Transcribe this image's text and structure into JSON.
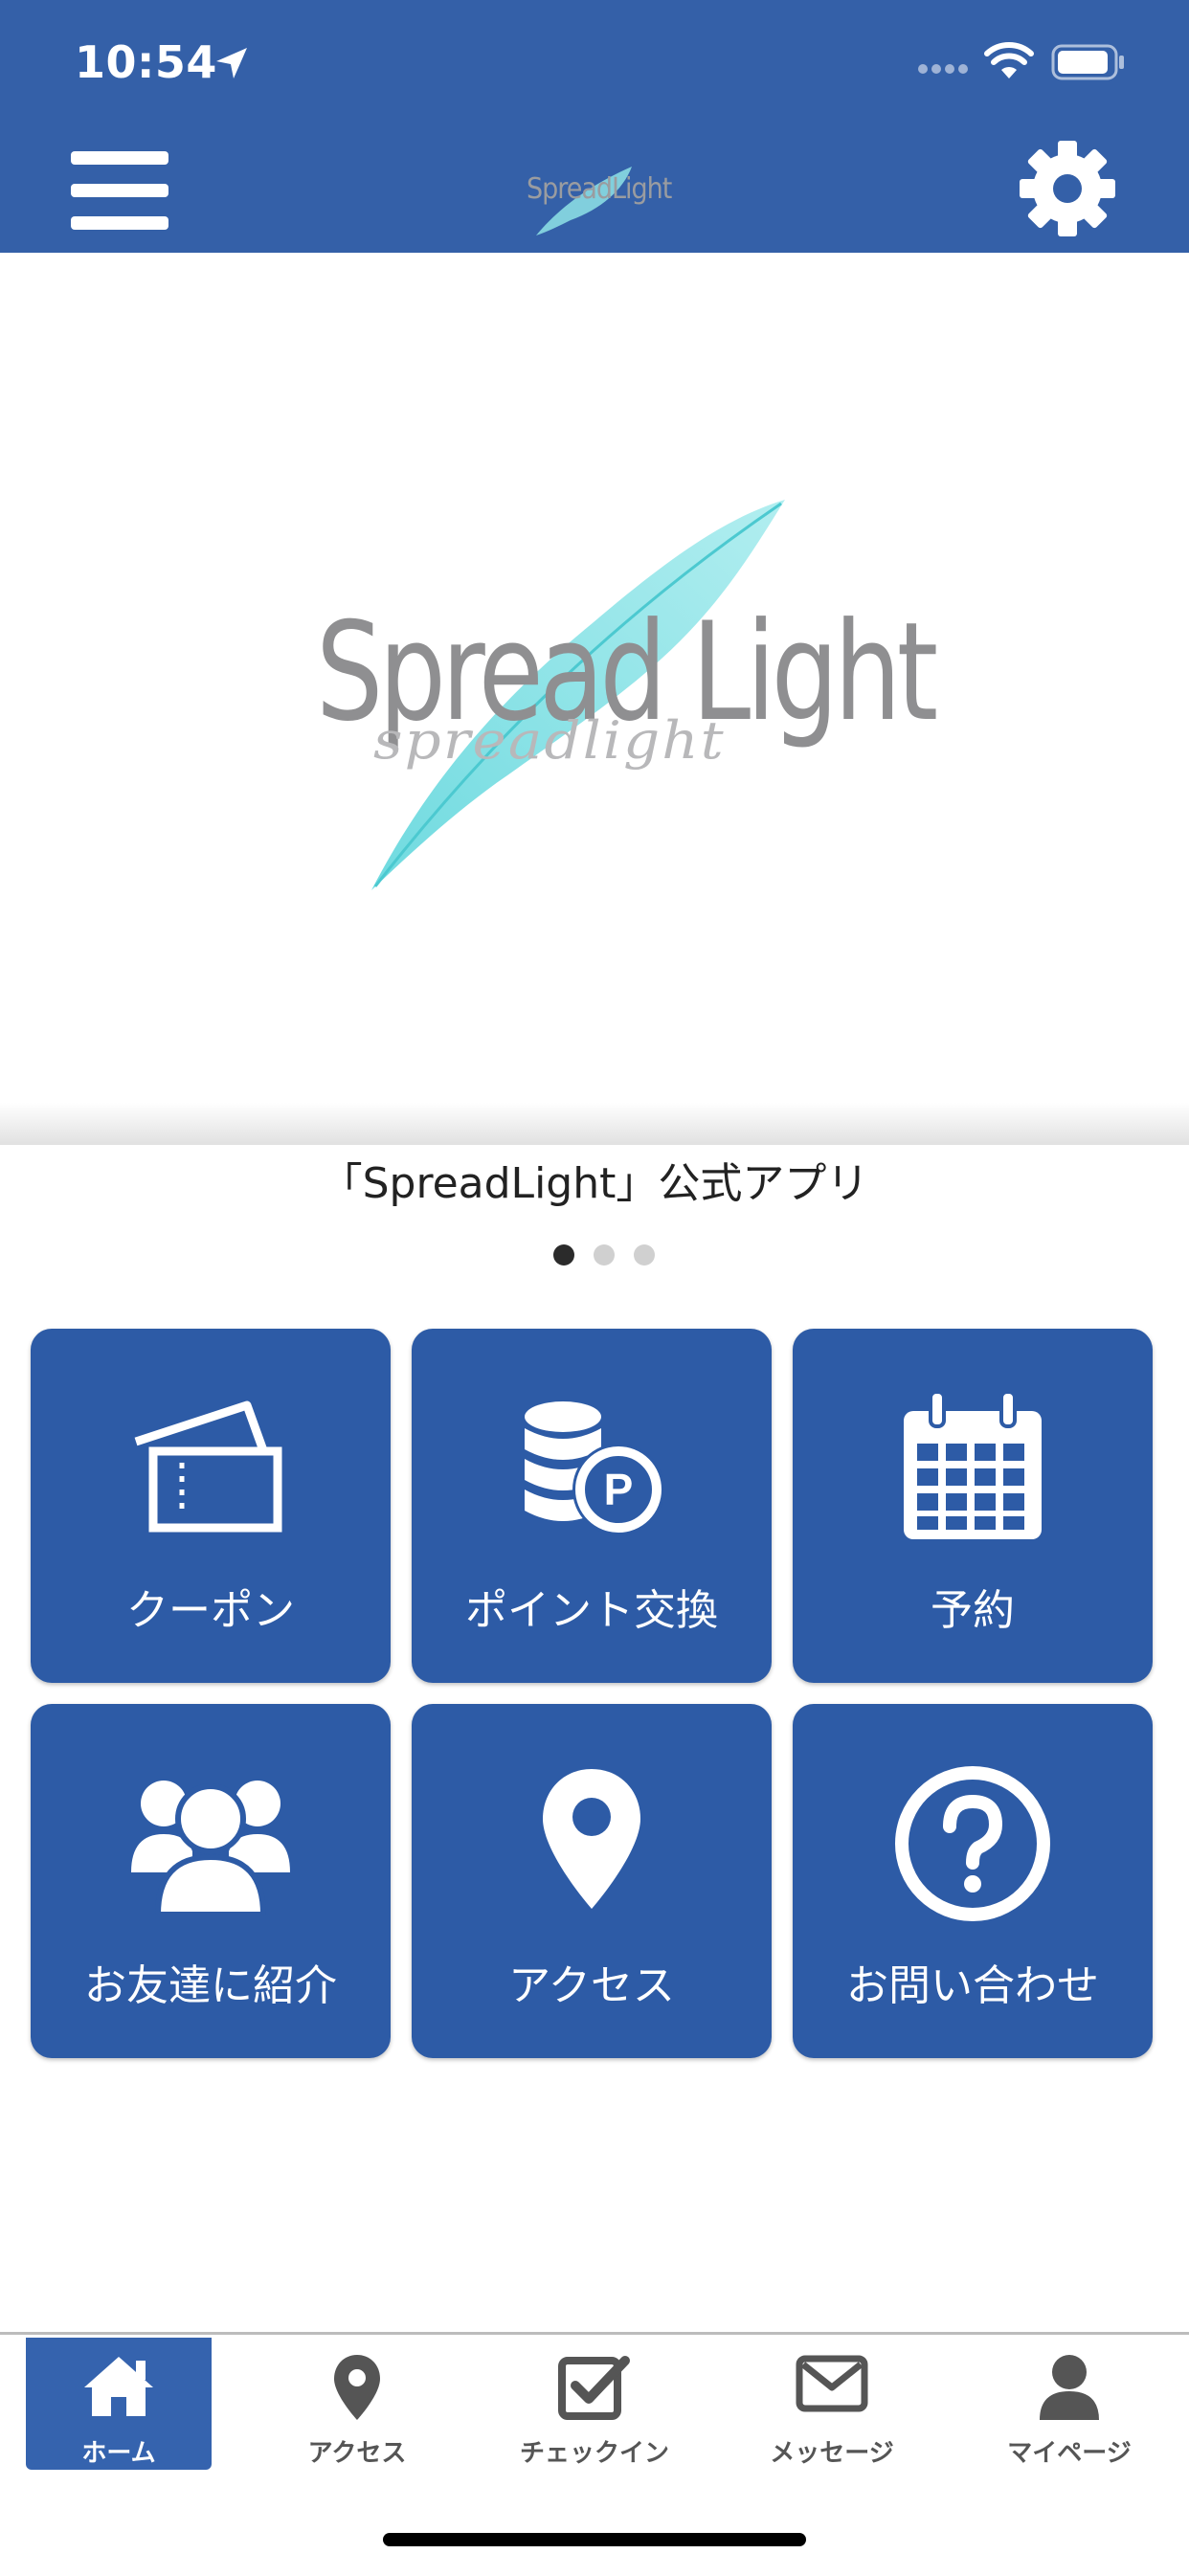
{
  "status_bar": {
    "time": "10:54"
  },
  "header": {
    "logo_text": "SpreadLight"
  },
  "hero": {
    "logo_text": "Spread Light",
    "logo_subtext": "spreadlight",
    "caption": "「SpreadLight」公式アプリ",
    "page_count": 3,
    "active_page": 1
  },
  "menu_tiles": [
    {
      "label": "クーポン",
      "icon": "ticket-icon"
    },
    {
      "label": "ポイント交換",
      "icon": "coins-point-icon"
    },
    {
      "label": "予約",
      "icon": "calendar-icon"
    },
    {
      "label": "お友達に紹介",
      "icon": "users-icon"
    },
    {
      "label": "アクセス",
      "icon": "map-pin-icon"
    },
    {
      "label": "お問い合わせ",
      "icon": "question-circle-icon"
    }
  ],
  "tabbar": {
    "items": [
      {
        "label": "ホーム",
        "icon": "home-icon",
        "active": true
      },
      {
        "label": "アクセス",
        "icon": "map-pin-icon"
      },
      {
        "label": "チェックイン",
        "icon": "checkbox-icon"
      },
      {
        "label": "メッセージ",
        "icon": "envelope-icon"
      },
      {
        "label": "マイページ",
        "icon": "user-icon"
      }
    ]
  },
  "colors": {
    "header_bg": "#3460a8",
    "tile_bg": "#2d5ba6",
    "tab_active_bg": "#3563ae",
    "feather": "#7fe0e4"
  }
}
